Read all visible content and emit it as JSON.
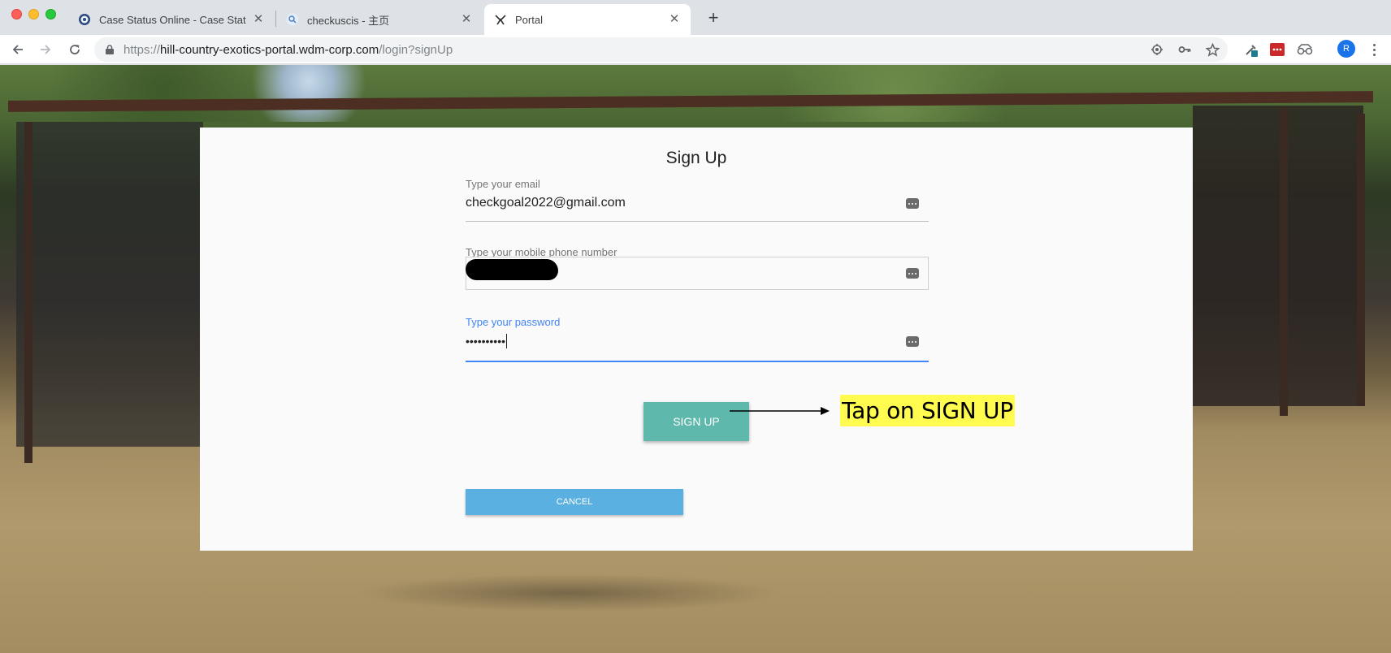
{
  "browser": {
    "tabs": [
      {
        "title": "Case Status Online - Case Stat",
        "favicon": "uscis-seal-icon",
        "active": false
      },
      {
        "title": "checkuscis - 主页",
        "favicon": "search-magnifier-icon",
        "active": false
      },
      {
        "title": "Portal",
        "favicon": "portal-logo-icon",
        "active": true
      }
    ],
    "url": {
      "scheme": "https://",
      "host": "hill-country-exotics-portal.wdm-corp.com",
      "path": "/login?signUp"
    },
    "profile_initial": "R"
  },
  "form": {
    "title": "Sign Up",
    "email": {
      "label": "Type your email",
      "value": "checkgoal2022@gmail.com"
    },
    "phone": {
      "label": "Type your mobile phone number",
      "value_redacted": true
    },
    "password": {
      "label": "Type your password",
      "value": "••••••••••"
    },
    "signup_button": "SIGN UP",
    "cancel_button": "CANCEL"
  },
  "annotation": {
    "text": "Tap on SIGN UP",
    "highlight_color": "#fffb4f"
  },
  "colors": {
    "signup_button": "#5fb8ac",
    "cancel_button": "#5ab0e0",
    "focus_blue": "#4285f4",
    "card_background": "#fafafa"
  }
}
